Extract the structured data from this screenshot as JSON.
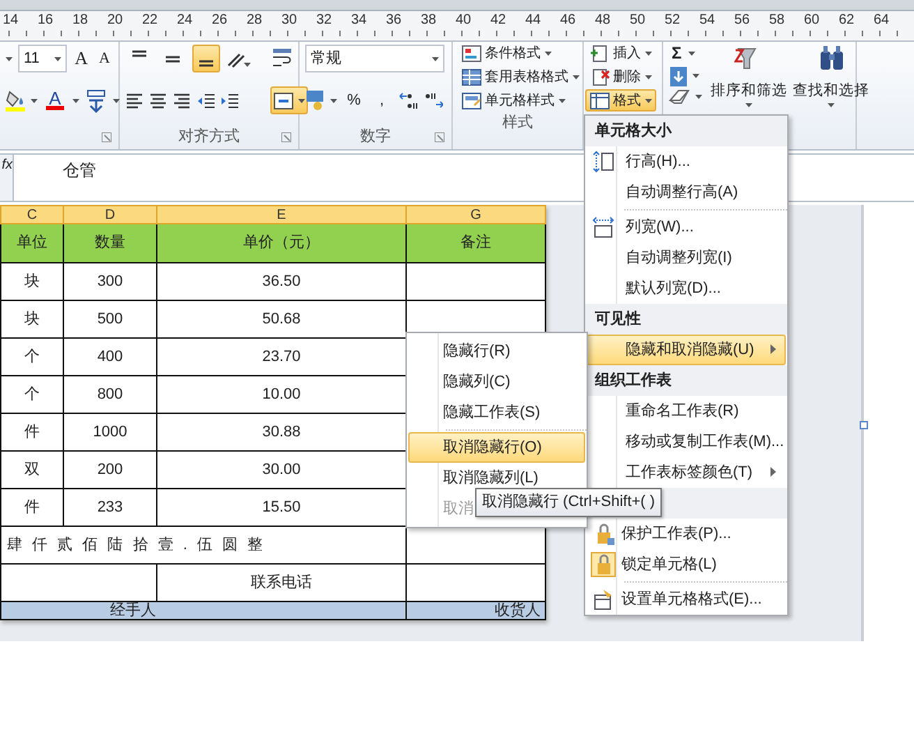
{
  "ruler": {
    "labels": [
      "14",
      "16",
      "18",
      "20",
      "22",
      "24",
      "26",
      "28",
      "30",
      "32",
      "34",
      "36",
      "38",
      "40",
      "42",
      "44",
      "46",
      "48",
      "50",
      "52",
      "54",
      "56",
      "58",
      "60",
      "62",
      "64"
    ]
  },
  "ribbon": {
    "font": {
      "size": "11",
      "grow": "A",
      "shrink": "A",
      "color_letter": "A"
    },
    "alignment": {
      "label": "对齐方式",
      "vertical_buttons": [
        {
          "selected": false
        },
        {
          "selected": false
        },
        {
          "selected": true
        }
      ],
      "merge_center": {
        "selected": true
      }
    },
    "number": {
      "format": "常规",
      "symbols": [
        "%",
        ","
      ],
      "label": "数字"
    },
    "styles": {
      "buttons": [
        "条件格式",
        "套用表格格式",
        "单元格样式"
      ],
      "label": "样式"
    },
    "cells": {
      "buttons": [
        {
          "label": "插入",
          "selected": false
        },
        {
          "label": "删除",
          "selected": false
        },
        {
          "label": "格式",
          "selected": true
        }
      ]
    },
    "editing": {
      "sum": "Σ",
      "buttons": [
        "排序和筛选",
        "查找和选择"
      ]
    }
  },
  "formula_bar": {
    "fx": "fx",
    "value": "仓管"
  },
  "sheet": {
    "columns": [
      {
        "label": "C",
        "selected": true
      },
      {
        "label": "D",
        "selected": true
      },
      {
        "label": "E",
        "selected": true
      },
      {
        "label": "G",
        "selected": true
      }
    ],
    "header": [
      "单位",
      "数量",
      "单价（元）",
      "备注"
    ],
    "rows": [
      [
        "块",
        "300",
        "36.50",
        ""
      ],
      [
        "块",
        "500",
        "50.68",
        ""
      ],
      [
        "个",
        "400",
        "23.70",
        ""
      ],
      [
        "个",
        "800",
        "10.00",
        ""
      ],
      [
        "件",
        "1000",
        "30.88",
        ""
      ],
      [
        "双",
        "200",
        "30.00",
        ""
      ],
      [
        "件",
        "233",
        "15.50",
        ""
      ]
    ],
    "amount_words": "肆 仟 贰 佰 陆 拾 壹 . 伍 圆 整",
    "phone_label": "联系电话",
    "footer": [
      "经手人",
      "收货人"
    ]
  },
  "format_menu": {
    "sections": [
      {
        "title": "单元格大小",
        "items": [
          {
            "label": "行高(H)...",
            "kind": "item",
            "selected": false,
            "checked": false
          },
          {
            "label": "自动调整行高(A)",
            "kind": "item",
            "selected": false,
            "checked": false
          },
          {
            "label": "列宽(W)...",
            "kind": "item",
            "selected": false,
            "checked": false
          },
          {
            "label": "自动调整列宽(I)",
            "kind": "item",
            "selected": false,
            "checked": false
          },
          {
            "label": "默认列宽(D)...",
            "kind": "item",
            "selected": false,
            "checked": false
          }
        ]
      },
      {
        "title": "可见性",
        "items": [
          {
            "label": "隐藏和取消隐藏(U)",
            "kind": "submenu",
            "selected": true,
            "checked": false
          }
        ]
      },
      {
        "title": "组织工作表",
        "items": [
          {
            "label": "重命名工作表(R)",
            "kind": "item",
            "selected": false,
            "checked": false
          },
          {
            "label": "移动或复制工作表(M)...",
            "kind": "item",
            "selected": false,
            "checked": false
          },
          {
            "label": "工作表标签颜色(T)",
            "kind": "submenu",
            "selected": false,
            "checked": false
          }
        ]
      },
      {
        "items": [
          {
            "label": "保护工作表(P)...",
            "kind": "item",
            "selected": false,
            "checked": false
          },
          {
            "label": "锁定单元格(L)",
            "kind": "item",
            "selected": false,
            "checked": true
          },
          {
            "label": "设置单元格格式(E)...",
            "kind": "item",
            "selected": false,
            "checked": false
          }
        ]
      }
    ]
  },
  "submenu": {
    "items": [
      {
        "label": "隐藏行(R)",
        "selected": false,
        "disabled": false
      },
      {
        "label": "隐藏列(C)",
        "selected": false,
        "disabled": false
      },
      {
        "label": "隐藏工作表(S)",
        "selected": false,
        "disabled": false
      },
      {
        "label": "取消隐藏行(O)",
        "selected": true,
        "disabled": false
      },
      {
        "label": "取消隐藏列(L)",
        "selected": false,
        "disabled": false
      },
      {
        "label": "取消",
        "selected": false,
        "disabled": true
      }
    ]
  },
  "tooltip": {
    "text": "取消隐藏行 (Ctrl+Shift+( )"
  }
}
